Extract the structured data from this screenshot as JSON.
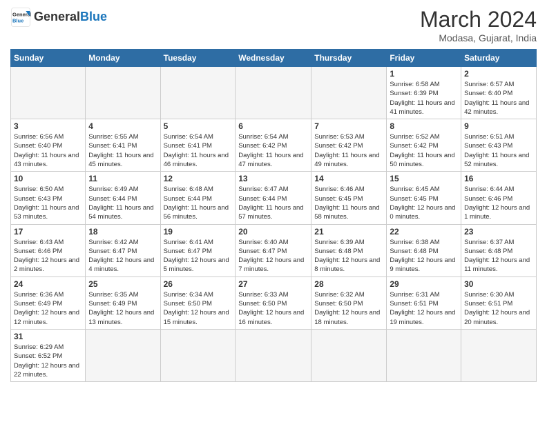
{
  "header": {
    "logo_general": "General",
    "logo_blue": "Blue",
    "month_title": "March 2024",
    "location": "Modasa, Gujarat, India"
  },
  "weekdays": [
    "Sunday",
    "Monday",
    "Tuesday",
    "Wednesday",
    "Thursday",
    "Friday",
    "Saturday"
  ],
  "weeks": [
    [
      {
        "day": "",
        "info": ""
      },
      {
        "day": "",
        "info": ""
      },
      {
        "day": "",
        "info": ""
      },
      {
        "day": "",
        "info": ""
      },
      {
        "day": "",
        "info": ""
      },
      {
        "day": "1",
        "info": "Sunrise: 6:58 AM\nSunset: 6:39 PM\nDaylight: 11 hours and 41 minutes."
      },
      {
        "day": "2",
        "info": "Sunrise: 6:57 AM\nSunset: 6:40 PM\nDaylight: 11 hours and 42 minutes."
      }
    ],
    [
      {
        "day": "3",
        "info": "Sunrise: 6:56 AM\nSunset: 6:40 PM\nDaylight: 11 hours and 43 minutes."
      },
      {
        "day": "4",
        "info": "Sunrise: 6:55 AM\nSunset: 6:41 PM\nDaylight: 11 hours and 45 minutes."
      },
      {
        "day": "5",
        "info": "Sunrise: 6:54 AM\nSunset: 6:41 PM\nDaylight: 11 hours and 46 minutes."
      },
      {
        "day": "6",
        "info": "Sunrise: 6:54 AM\nSunset: 6:42 PM\nDaylight: 11 hours and 47 minutes."
      },
      {
        "day": "7",
        "info": "Sunrise: 6:53 AM\nSunset: 6:42 PM\nDaylight: 11 hours and 49 minutes."
      },
      {
        "day": "8",
        "info": "Sunrise: 6:52 AM\nSunset: 6:42 PM\nDaylight: 11 hours and 50 minutes."
      },
      {
        "day": "9",
        "info": "Sunrise: 6:51 AM\nSunset: 6:43 PM\nDaylight: 11 hours and 52 minutes."
      }
    ],
    [
      {
        "day": "10",
        "info": "Sunrise: 6:50 AM\nSunset: 6:43 PM\nDaylight: 11 hours and 53 minutes."
      },
      {
        "day": "11",
        "info": "Sunrise: 6:49 AM\nSunset: 6:44 PM\nDaylight: 11 hours and 54 minutes."
      },
      {
        "day": "12",
        "info": "Sunrise: 6:48 AM\nSunset: 6:44 PM\nDaylight: 11 hours and 56 minutes."
      },
      {
        "day": "13",
        "info": "Sunrise: 6:47 AM\nSunset: 6:44 PM\nDaylight: 11 hours and 57 minutes."
      },
      {
        "day": "14",
        "info": "Sunrise: 6:46 AM\nSunset: 6:45 PM\nDaylight: 11 hours and 58 minutes."
      },
      {
        "day": "15",
        "info": "Sunrise: 6:45 AM\nSunset: 6:45 PM\nDaylight: 12 hours and 0 minutes."
      },
      {
        "day": "16",
        "info": "Sunrise: 6:44 AM\nSunset: 6:46 PM\nDaylight: 12 hours and 1 minute."
      }
    ],
    [
      {
        "day": "17",
        "info": "Sunrise: 6:43 AM\nSunset: 6:46 PM\nDaylight: 12 hours and 2 minutes."
      },
      {
        "day": "18",
        "info": "Sunrise: 6:42 AM\nSunset: 6:47 PM\nDaylight: 12 hours and 4 minutes."
      },
      {
        "day": "19",
        "info": "Sunrise: 6:41 AM\nSunset: 6:47 PM\nDaylight: 12 hours and 5 minutes."
      },
      {
        "day": "20",
        "info": "Sunrise: 6:40 AM\nSunset: 6:47 PM\nDaylight: 12 hours and 7 minutes."
      },
      {
        "day": "21",
        "info": "Sunrise: 6:39 AM\nSunset: 6:48 PM\nDaylight: 12 hours and 8 minutes."
      },
      {
        "day": "22",
        "info": "Sunrise: 6:38 AM\nSunset: 6:48 PM\nDaylight: 12 hours and 9 minutes."
      },
      {
        "day": "23",
        "info": "Sunrise: 6:37 AM\nSunset: 6:48 PM\nDaylight: 12 hours and 11 minutes."
      }
    ],
    [
      {
        "day": "24",
        "info": "Sunrise: 6:36 AM\nSunset: 6:49 PM\nDaylight: 12 hours and 12 minutes."
      },
      {
        "day": "25",
        "info": "Sunrise: 6:35 AM\nSunset: 6:49 PM\nDaylight: 12 hours and 13 minutes."
      },
      {
        "day": "26",
        "info": "Sunrise: 6:34 AM\nSunset: 6:50 PM\nDaylight: 12 hours and 15 minutes."
      },
      {
        "day": "27",
        "info": "Sunrise: 6:33 AM\nSunset: 6:50 PM\nDaylight: 12 hours and 16 minutes."
      },
      {
        "day": "28",
        "info": "Sunrise: 6:32 AM\nSunset: 6:50 PM\nDaylight: 12 hours and 18 minutes."
      },
      {
        "day": "29",
        "info": "Sunrise: 6:31 AM\nSunset: 6:51 PM\nDaylight: 12 hours and 19 minutes."
      },
      {
        "day": "30",
        "info": "Sunrise: 6:30 AM\nSunset: 6:51 PM\nDaylight: 12 hours and 20 minutes."
      }
    ],
    [
      {
        "day": "31",
        "info": "Sunrise: 6:29 AM\nSunset: 6:52 PM\nDaylight: 12 hours and 22 minutes."
      },
      {
        "day": "",
        "info": ""
      },
      {
        "day": "",
        "info": ""
      },
      {
        "day": "",
        "info": ""
      },
      {
        "day": "",
        "info": ""
      },
      {
        "day": "",
        "info": ""
      },
      {
        "day": "",
        "info": ""
      }
    ]
  ]
}
